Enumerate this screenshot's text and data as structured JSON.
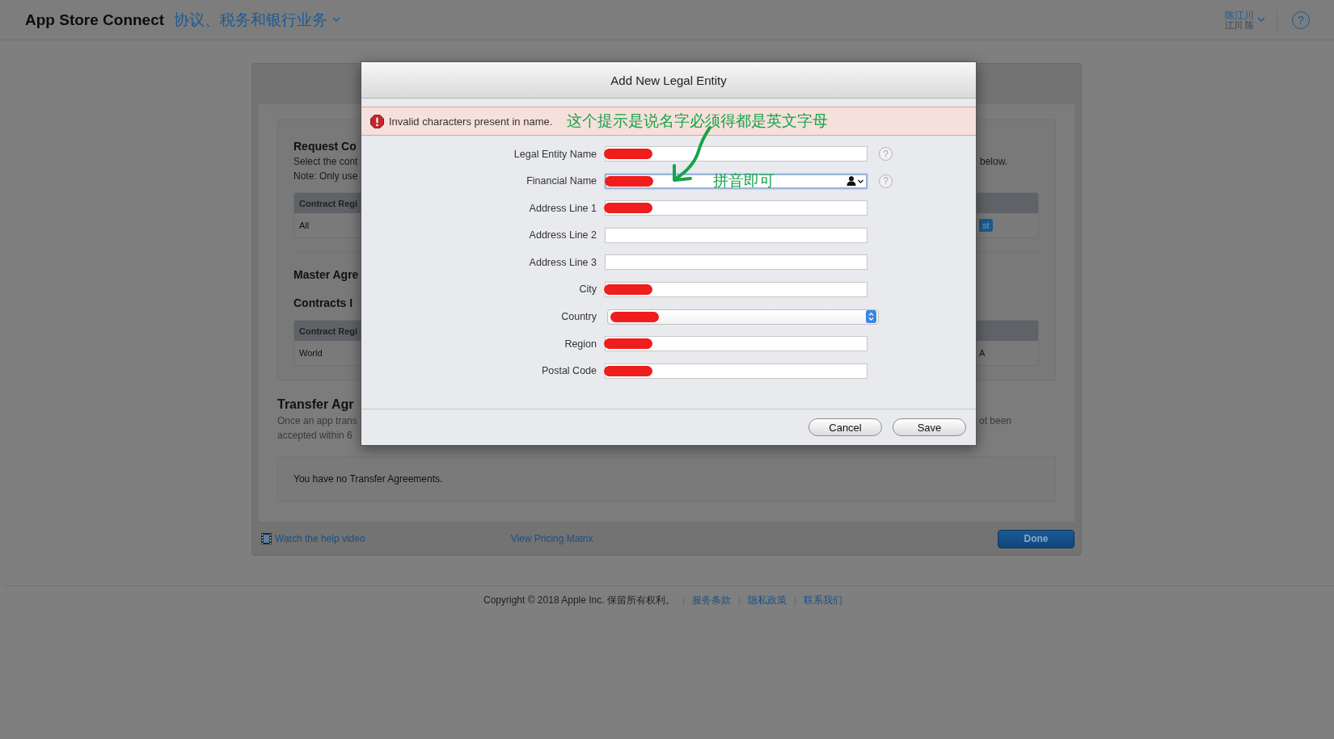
{
  "top_bar": {
    "app_title": "App Store Connect",
    "section": "协议、税务和银行业务",
    "user_name": "陈江川",
    "user_sub": "江川 陈",
    "help": "?"
  },
  "page": {
    "request": {
      "heading": "Request Co",
      "lines": [
        "Select the cont",
        "Note: Only use"
      ],
      "line_end": "below.",
      "table": {
        "header": "Contract Regi",
        "cell": "All",
        "action": "st"
      }
    },
    "master_heading": "Master Agre",
    "contracts": {
      "heading": "Contracts I",
      "table": {
        "header": "Contract Regi",
        "cell": "World",
        "cell_end": "A"
      }
    },
    "transfer": {
      "heading": "Transfer Agr",
      "lines": [
        "Once an app trans",
        "accepted within 6"
      ],
      "line_end": "ot been",
      "empty_message": "You have no Transfer Agreements."
    },
    "links": [
      {
        "label": "Watch the help video",
        "kind": "video"
      },
      {
        "label": "View Pricing Matrix",
        "kind": "plain"
      }
    ],
    "done": "Done"
  },
  "dialog": {
    "title": "Add New Legal Entity",
    "error": "Invalid characters present in name.",
    "fields": [
      {
        "label": "Legal Entity Name",
        "kind": "text",
        "redacted": true,
        "help": "?",
        "focused": false
      },
      {
        "label": "Financial Name",
        "kind": "contact",
        "redacted": true,
        "help": "?",
        "focused": true
      },
      {
        "label": "Address Line 1",
        "kind": "text",
        "redacted": true,
        "focused": false
      },
      {
        "label": "Address Line 2",
        "kind": "text",
        "redacted": false,
        "focused": false
      },
      {
        "label": "Address Line 3",
        "kind": "text",
        "redacted": false,
        "focused": false
      },
      {
        "label": "City",
        "kind": "text",
        "redacted": true,
        "focused": false
      },
      {
        "label": "Country",
        "kind": "select",
        "redacted": true
      },
      {
        "label": "Region",
        "kind": "text",
        "redacted": true,
        "focused": false
      },
      {
        "label": "Postal Code",
        "kind": "text",
        "redacted": true,
        "focused": false
      }
    ],
    "buttons": [
      {
        "label": "Cancel"
      },
      {
        "label": "Save"
      }
    ]
  },
  "annotations": [
    {
      "text": "这个提示是说名字必须得都是英文字母",
      "kind": "banner-note"
    },
    {
      "text": "拼音即可",
      "kind": "field-note"
    }
  ],
  "footer": {
    "copyright": "Copyright © 2018 Apple Inc. 保留所有权利。",
    "links": [
      "服务条款",
      "隐私政策",
      "联系我们"
    ]
  }
}
